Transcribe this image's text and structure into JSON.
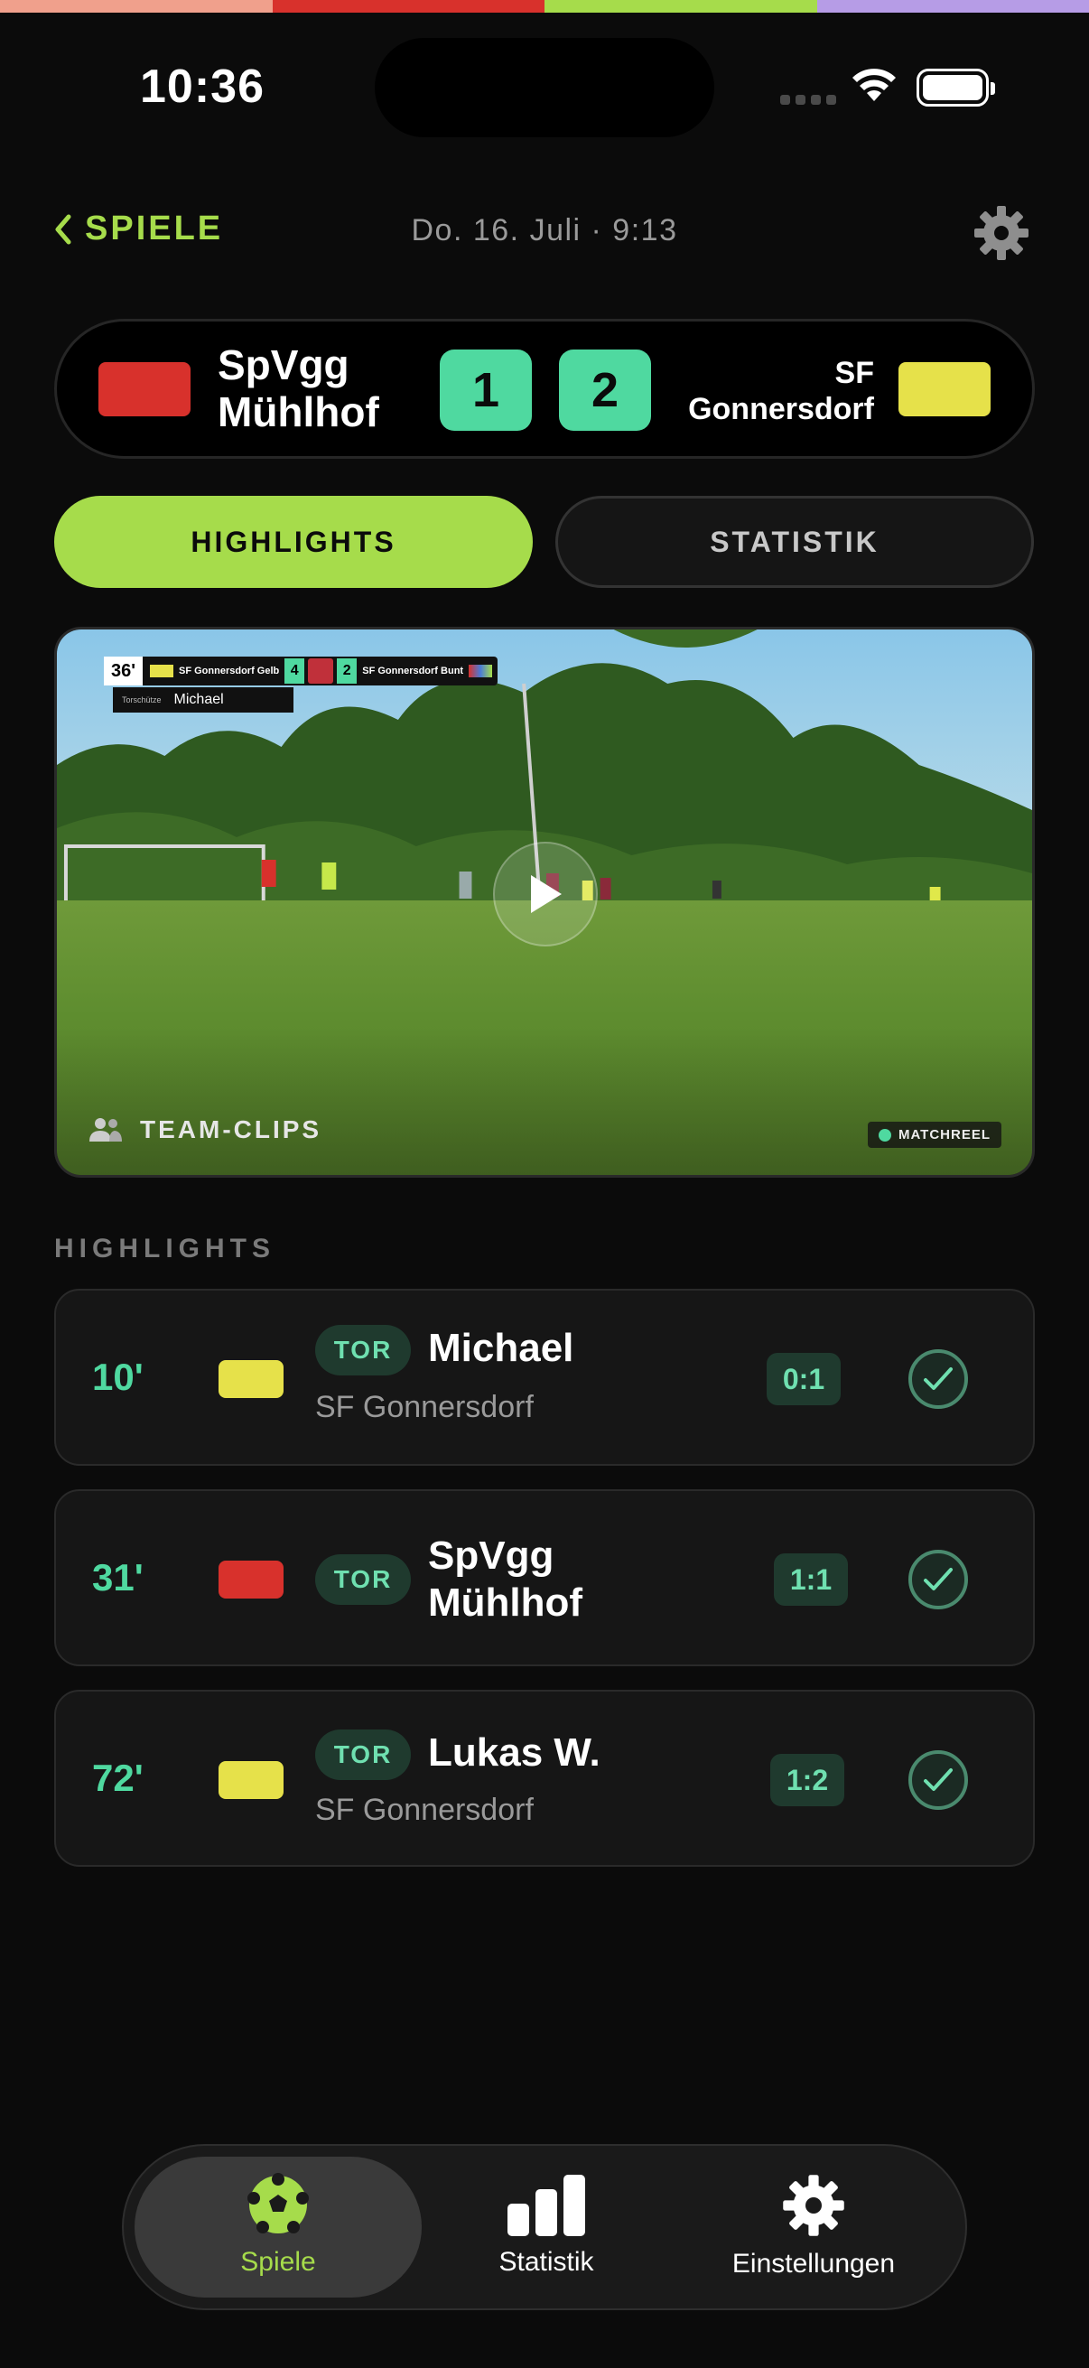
{
  "status": {
    "time": "10:36"
  },
  "nav": {
    "back_label": "SPIELE",
    "date": "Do. 16. Juli · 9:13"
  },
  "match": {
    "home": {
      "name_line1": "SpVgg",
      "name_line2": "Mühlhof",
      "color": "#d8312c",
      "score": "1"
    },
    "away": {
      "name_line1": "SF",
      "name_line2": "Gonnersdorf",
      "color": "#e6e14a",
      "score": "2"
    }
  },
  "tabs": {
    "highlights": "HIGHLIGHTS",
    "statistik": "STATISTIK"
  },
  "video": {
    "scorebug": {
      "minute": "36'",
      "home": "SF Gonnersdorf Gelb",
      "home_score": "4",
      "away_score": "2",
      "away": "SF Gonnersdorf Bunt",
      "scorer_label": "Torschütze",
      "scorer": "Michael"
    },
    "clips_label": "TEAM-CLIPS",
    "brand": "MATCHREEL"
  },
  "section_title": "HIGHLIGHTS",
  "highlights": [
    {
      "minute": "10'",
      "color": "#e6e14a",
      "tag": "TOR",
      "player": "Michael",
      "team": "SF Gonnersdorf",
      "result": "0:1"
    },
    {
      "minute": "31'",
      "color": "#d8312c",
      "tag": "TOR",
      "player_line1": "SpVgg",
      "player_line2": "Mühlhof",
      "result": "1:1"
    },
    {
      "minute": "72'",
      "color": "#e6e14a",
      "tag": "TOR",
      "player": "Lukas W.",
      "team": "SF Gonnersdorf",
      "result": "1:2"
    }
  ],
  "tabbar": {
    "spiele": "Spiele",
    "statistik": "Statistik",
    "einstellungen": "Einstellungen"
  },
  "colors": {
    "accent": "#a6dc4b",
    "score": "#4fd9a0"
  }
}
